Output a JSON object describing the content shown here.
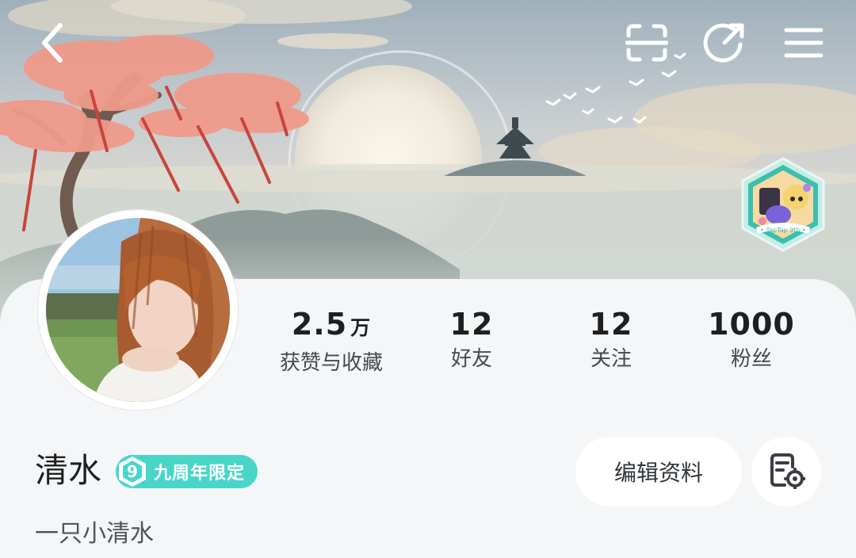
{
  "header": {
    "back_icon": "chevron-left-icon",
    "scan_icon": "scan-icon",
    "share_icon": "share-icon",
    "menu_icon": "hamburger-menu-icon"
  },
  "badge": {
    "text": "• TapTap 9th •"
  },
  "profile": {
    "name": "清水",
    "anniversary_tag": {
      "number": "9",
      "label": "九周年限定"
    },
    "bio": "一只小清水"
  },
  "stats": [
    {
      "value": "2.5",
      "unit": "万",
      "label": "获赞与收藏"
    },
    {
      "value": "12",
      "unit": "",
      "label": "好友"
    },
    {
      "value": "12",
      "unit": "",
      "label": "关注"
    },
    {
      "value": "1000",
      "unit": "",
      "label": "粉丝"
    }
  ],
  "actions": {
    "edit_label": "编辑资料",
    "settings_icon": "profile-settings-icon"
  },
  "colors": {
    "accent": "#49d6c9",
    "text": "#1d1f21",
    "card_bg": "#f4f6f8"
  }
}
